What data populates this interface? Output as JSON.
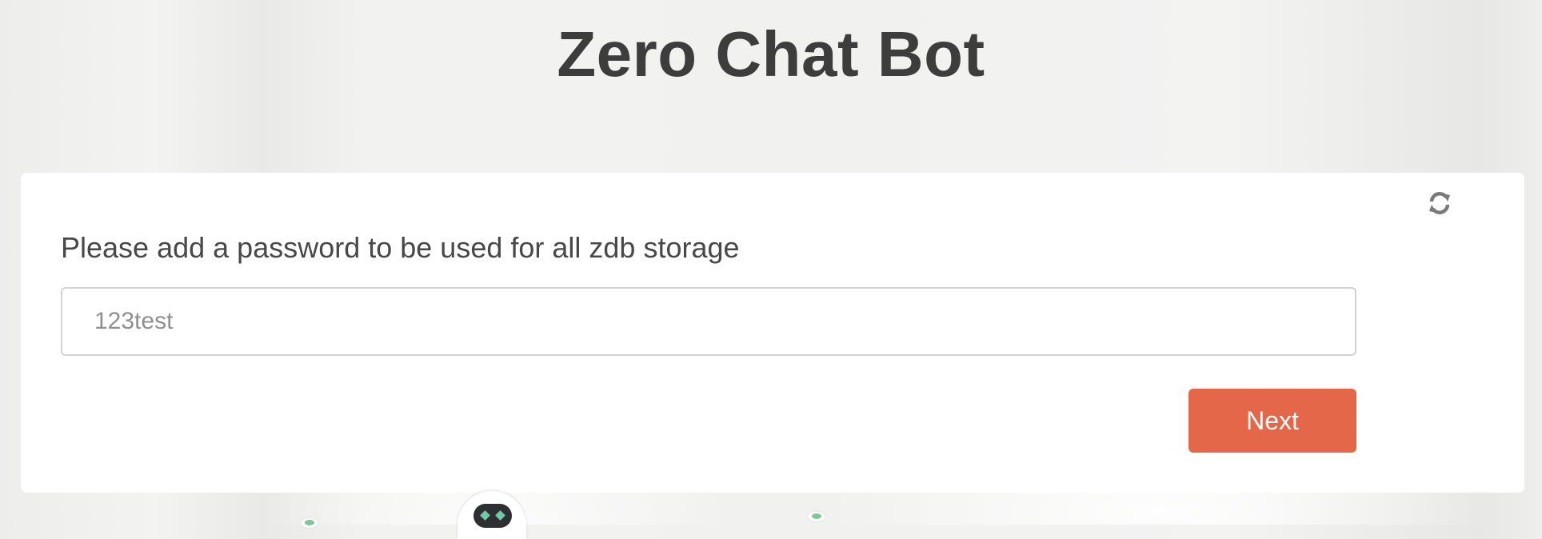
{
  "page": {
    "title": "Zero Chat Bot"
  },
  "form": {
    "prompt": "Please add a password to be used for all zdb storage",
    "password_value": "123test",
    "next_label": "Next"
  },
  "icons": {
    "refresh": "refresh-icon",
    "mascot": "robot-mascot-icon"
  },
  "colors": {
    "accent": "#e4674a",
    "title_text": "#3d3d3d",
    "card_background": "#ffffff"
  }
}
